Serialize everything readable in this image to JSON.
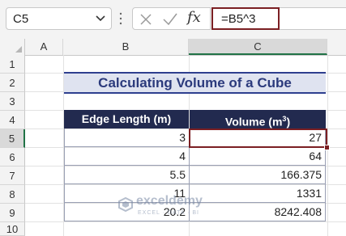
{
  "formula_bar": {
    "name_box": "C5",
    "fx_label": "fx",
    "formula": "=B5^3"
  },
  "columns": [
    "A",
    "B",
    "C"
  ],
  "rows": [
    "1",
    "2",
    "3",
    "4",
    "5",
    "6",
    "7",
    "8",
    "9",
    "10"
  ],
  "sheet": {
    "title": "Calculating Volume of a Cube",
    "headers": {
      "edge": "Edge Length (m)",
      "volume_prefix": "Volume (m",
      "volume_sup": "3",
      "volume_suffix": ")"
    },
    "data": [
      {
        "edge": "3",
        "volume": "27"
      },
      {
        "edge": "4",
        "volume": "64"
      },
      {
        "edge": "5.5",
        "volume": "166.375"
      },
      {
        "edge": "11",
        "volume": "1331"
      },
      {
        "edge": "20.2",
        "volume": "8242.408"
      }
    ]
  },
  "watermark": {
    "name": "exceldemy",
    "tagline": "EXCEL · DATA · BI"
  },
  "colors": {
    "accent": "#7b1f23",
    "header_bg": "#222a4f",
    "title_bg": "#dfe3f0",
    "title_text": "#2b3a7c",
    "selection": "#217346"
  }
}
